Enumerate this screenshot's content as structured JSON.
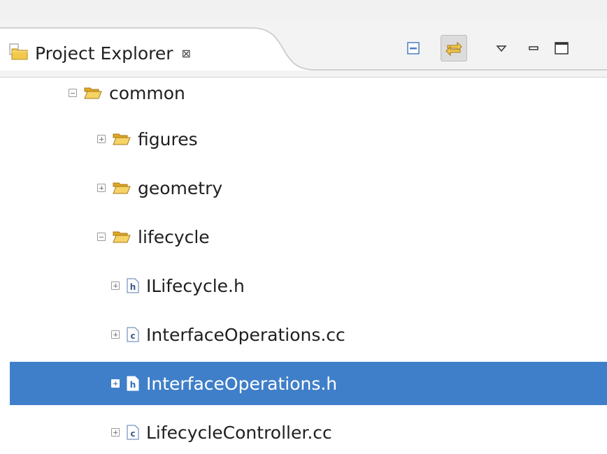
{
  "panel": {
    "title": "Project Explorer",
    "close_glyph": "⊠",
    "icon": "project-folder-icon"
  },
  "toolbar": {
    "buttons": [
      {
        "name": "collapse-all-button",
        "icon": "collapse-all-icon",
        "active": false
      },
      {
        "name": "link-with-editor-button",
        "icon": "link-with-editor-icon",
        "active": true
      },
      {
        "name": "view-menu-button",
        "icon": "chevron-down-icon",
        "active": false
      },
      {
        "name": "minimize-button",
        "icon": "minimize-icon",
        "active": false
      },
      {
        "name": "maximize-button",
        "icon": "maximize-icon",
        "active": false
      }
    ]
  },
  "tree": {
    "items": [
      {
        "label": "common",
        "type": "folder",
        "expanded": true,
        "selected": false
      },
      {
        "label": "figures",
        "type": "folder",
        "expanded": false,
        "selected": false
      },
      {
        "label": "geometry",
        "type": "folder",
        "expanded": false,
        "selected": false
      },
      {
        "label": "lifecycle",
        "type": "folder",
        "expanded": true,
        "selected": false
      },
      {
        "label": "ILifecycle.h",
        "type": "header-file",
        "expanded": false,
        "selected": false
      },
      {
        "label": "InterfaceOperations.cc",
        "type": "source-file",
        "expanded": false,
        "selected": false
      },
      {
        "label": "InterfaceOperations.h",
        "type": "header-file",
        "expanded": false,
        "selected": true
      },
      {
        "label": "LifecycleController.cc",
        "type": "source-file",
        "expanded": false,
        "selected": false
      }
    ]
  },
  "colors": {
    "selection": "#3f7fc9",
    "folder": "#f2c94c",
    "header_bg": "#f3f3f3"
  }
}
